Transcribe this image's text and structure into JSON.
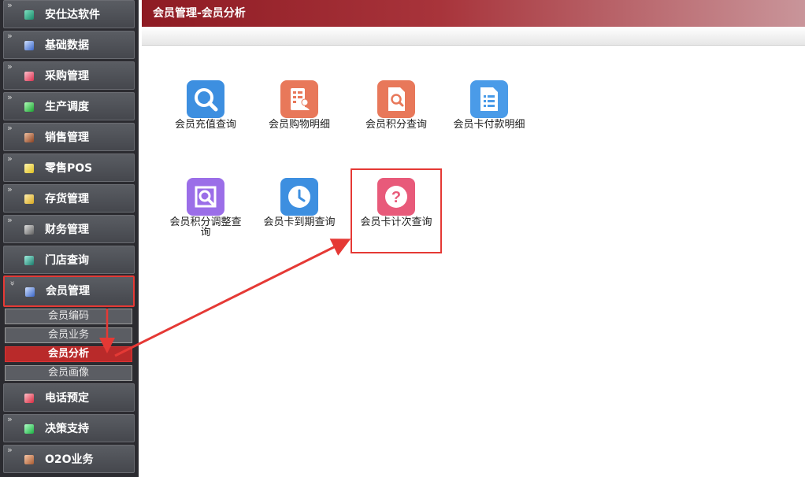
{
  "header": {
    "title": "会员管理-会员分析"
  },
  "sidebar": {
    "items": [
      {
        "label": "安仕达软件",
        "icon": "teal-icon",
        "color": "#2bb673"
      },
      {
        "label": "基础数据",
        "icon": "blue-icon",
        "color": "#4a7bd8"
      },
      {
        "label": "采购管理",
        "icon": "pink-icon",
        "color": "#e8506e"
      },
      {
        "label": "生产调度",
        "icon": "green-icon",
        "color": "#2ecc40"
      },
      {
        "label": "销售管理",
        "icon": "brown-icon",
        "color": "#b06a3b"
      },
      {
        "label": "零售POS",
        "icon": "yellow-icon",
        "color": "#f0d040"
      },
      {
        "label": "存货管理",
        "icon": "gold-icon",
        "color": "#e8c040"
      },
      {
        "label": "财务管理",
        "icon": "gray-icon",
        "color": "#9a9a9a"
      },
      {
        "label": "门店查询",
        "icon": "teal-icon",
        "color": "#2a9d8f"
      },
      {
        "label": "会员管理",
        "icon": "blue-icon",
        "color": "#5b8de0"
      },
      {
        "label": "电话预定",
        "icon": "red-icon",
        "color": "#e24a5a"
      },
      {
        "label": "决策支持",
        "icon": "green-icon",
        "color": "#33cc66"
      },
      {
        "label": "O2O业务",
        "icon": "orange-icon",
        "color": "#c8744a"
      }
    ],
    "sub_items": [
      {
        "label": "会员编码"
      },
      {
        "label": "会员业务"
      },
      {
        "label": "会员分析"
      },
      {
        "label": "会员画像"
      }
    ]
  },
  "tiles": [
    {
      "label": "会员充值查询",
      "icon": "search-icon",
      "color": "#3d8fe0"
    },
    {
      "label": "会员购物明细",
      "icon": "receipt-person-icon",
      "color": "#e8785a"
    },
    {
      "label": "会员积分查询",
      "icon": "document-search-icon",
      "color": "#e8785a"
    },
    {
      "label": "会员卡付款明细",
      "icon": "document-list-icon",
      "color": "#4a9be8"
    },
    {
      "label": "会员积分调整查询",
      "icon": "frame-search-icon",
      "color": "#9b6ee8"
    },
    {
      "label": "会员卡到期查询",
      "icon": "clock-icon",
      "color": "#3d8fe0"
    },
    {
      "label": "会员卡计次查询",
      "icon": "question-icon",
      "color": "#e85a7a"
    }
  ]
}
